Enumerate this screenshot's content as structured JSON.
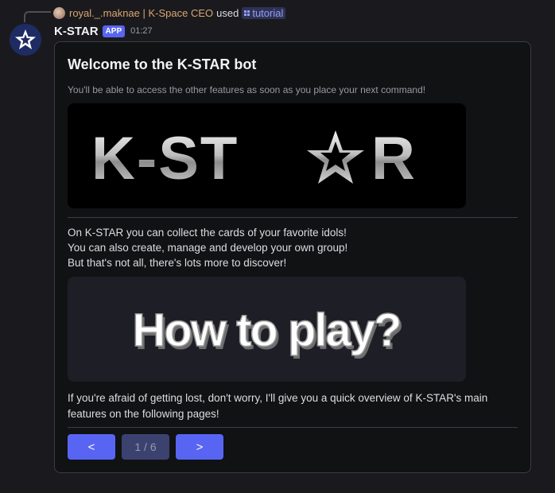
{
  "reply": {
    "author": "royal._.maknae | K-Space CEO",
    "used_text": "used",
    "command": "tutorial"
  },
  "message": {
    "bot_name": "K-STAR",
    "badge": "APP",
    "timestamp": "01:27"
  },
  "embed": {
    "title": "Welcome to the K-STAR bot",
    "subtitle": "You'll be able to access the other features as soon as you place your next command!",
    "banner_text_left": "K-ST",
    "banner_text_right": "R",
    "paragraphs": [
      "On K-STAR you can collect the cards of your favorite idols!",
      "You can also create, manage and develop your own group!",
      "But that's not all, there's lots more to discover!"
    ],
    "image2_text": "How to play?",
    "footer_lines": [
      "If you're afraid of getting lost, don't worry, I'll give you a quick overview of K-STAR's main",
      "features on the following pages!"
    ],
    "buttons": {
      "prev": "<",
      "page": "1 / 6",
      "next": ">"
    }
  },
  "colors": {
    "accent": "#5865f2",
    "page_button": "#3c4270",
    "username": "#d9a56f",
    "command": "#949cf7"
  }
}
